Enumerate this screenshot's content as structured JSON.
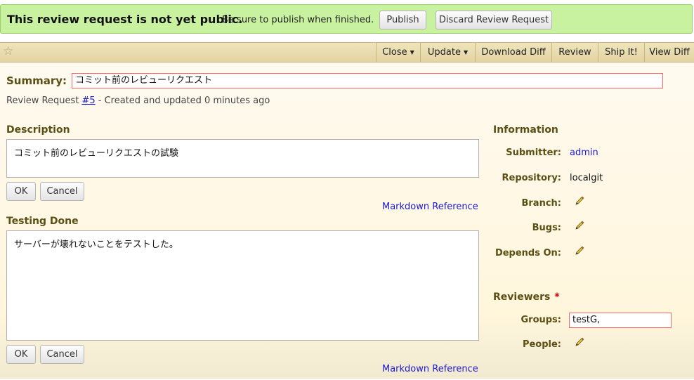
{
  "banner": {
    "strong": "This review request is not yet public.",
    "message": "Be sure to publish when finished.",
    "publish_label": "Publish",
    "discard_label": "Discard Review Request"
  },
  "actions": {
    "close": "Close",
    "update": "Update",
    "download_diff": "Download Diff",
    "review": "Review",
    "ship_it": "Ship It!",
    "view_diff": "View Diff"
  },
  "summary": {
    "label": "Summary:",
    "value": "コミット前のレビューリクエスト"
  },
  "request": {
    "prefix": "Review Request",
    "id": "#5",
    "suffix": "- Created and updated 0 minutes ago"
  },
  "description": {
    "title": "Description",
    "text": "コミット前のレビューリクエストの試験",
    "ok": "OK",
    "cancel": "Cancel",
    "markdown_ref": "Markdown Reference"
  },
  "testing": {
    "title": "Testing Done",
    "text": "サーバーが壊れないことをテストした。",
    "ok": "OK",
    "cancel": "Cancel",
    "markdown_ref": "Markdown Reference"
  },
  "information": {
    "title": "Information",
    "submitter_label": "Submitter:",
    "submitter_value": "admin",
    "repository_label": "Repository:",
    "repository_value": "localgit",
    "branch_label": "Branch:",
    "bugs_label": "Bugs:",
    "depends_label": "Depends On:"
  },
  "reviewers": {
    "title": "Reviewers",
    "required_mark": "*",
    "groups_label": "Groups:",
    "groups_value": "testG,",
    "people_label": "People:"
  }
}
